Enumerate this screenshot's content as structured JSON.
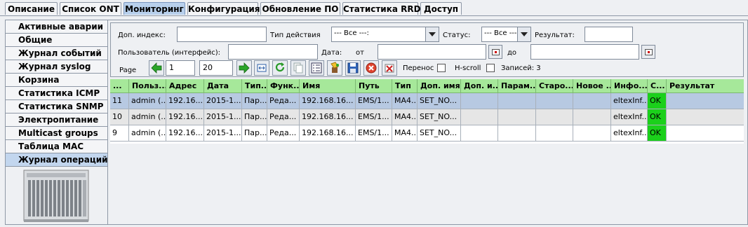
{
  "tabs": [
    "Описание",
    "Список ONT",
    "Мониторинг",
    "Конфигурация",
    "Обновление ПО",
    "Статистика RRD",
    "Доступ"
  ],
  "sidebar": [
    "Активные аварии",
    "Общие",
    "Журнал событий",
    "Журнал syslog",
    "Корзина",
    "Статистика ICMP",
    "Статистика SNMP",
    "Электропитание",
    "Multicast groups",
    "Таблица MAC",
    "Журнал операций"
  ],
  "filter": {
    "extra_index_label": "Доп. индекс:",
    "extra_index_value": "",
    "action_type_label": "Тип действия",
    "action_type_value": "--- Все ---:",
    "status_label": "Статус:",
    "status_value": "--- Все ---",
    "result_label": "Результат:",
    "result_value": "",
    "user_label": "Пользователь (интерфейс):",
    "user_value": "",
    "date_label": "Дата:",
    "from_label": "от",
    "from_value": "",
    "to_label": "до",
    "to_value": ""
  },
  "toolbar": {
    "page_label": "Page",
    "page_value": "1",
    "page_size_value": "20",
    "wrap_label": "Перенос",
    "hscroll_label": "H-scroll",
    "records_label": "Записей: 3",
    "icons": [
      "back-arrow-icon",
      "forward-arrow-icon",
      "fit-columns-icon",
      "refresh-icon",
      "copy-icon",
      "columns-list-icon",
      "paint-icon",
      "save-icon",
      "stop-icon",
      "clear-filter-icon"
    ]
  },
  "table": {
    "columns": [
      "...",
      "Польз...",
      "Адрес",
      "Дата",
      "Тип...",
      "Функ...",
      "Имя",
      "Путь",
      "Тип",
      "Доп. имя",
      "Доп. и...",
      "Парам...",
      "Старо...",
      "Новое ...",
      "Инфо...",
      "С...",
      "Результат"
    ],
    "rows": [
      [
        "11",
        "admin (...",
        "192.16...",
        "2015-1...",
        "Пар...",
        "Реда...",
        "192.168.16...",
        "EMS/1...",
        "MA4...",
        "SET_NO...",
        "",
        "",
        "",
        "",
        "eltexInf...",
        "OK",
        ""
      ],
      [
        "10",
        "admin (...",
        "192.16...",
        "2015-1...",
        "Пар...",
        "Реда...",
        "192.168.16...",
        "EMS/1...",
        "MA4...",
        "SET_NO...",
        "",
        "",
        "",
        "",
        "eltexInf...",
        "OK",
        ""
      ],
      [
        "9",
        "admin (...",
        "192.16...",
        "2015-1...",
        "Пар...",
        "Реда...",
        "192.168.16...",
        "EMS/1...",
        "MA4...",
        "SET_NO...",
        "",
        "",
        "",
        "",
        "eltexInf...",
        "OK",
        ""
      ]
    ]
  },
  "colors": {
    "header_green": "#a6e89a",
    "ok_green": "#1bd01b",
    "selected_row": "#b7c9e2",
    "second_row": "#e6e6e6",
    "active_tab": "#b8d0ec"
  }
}
